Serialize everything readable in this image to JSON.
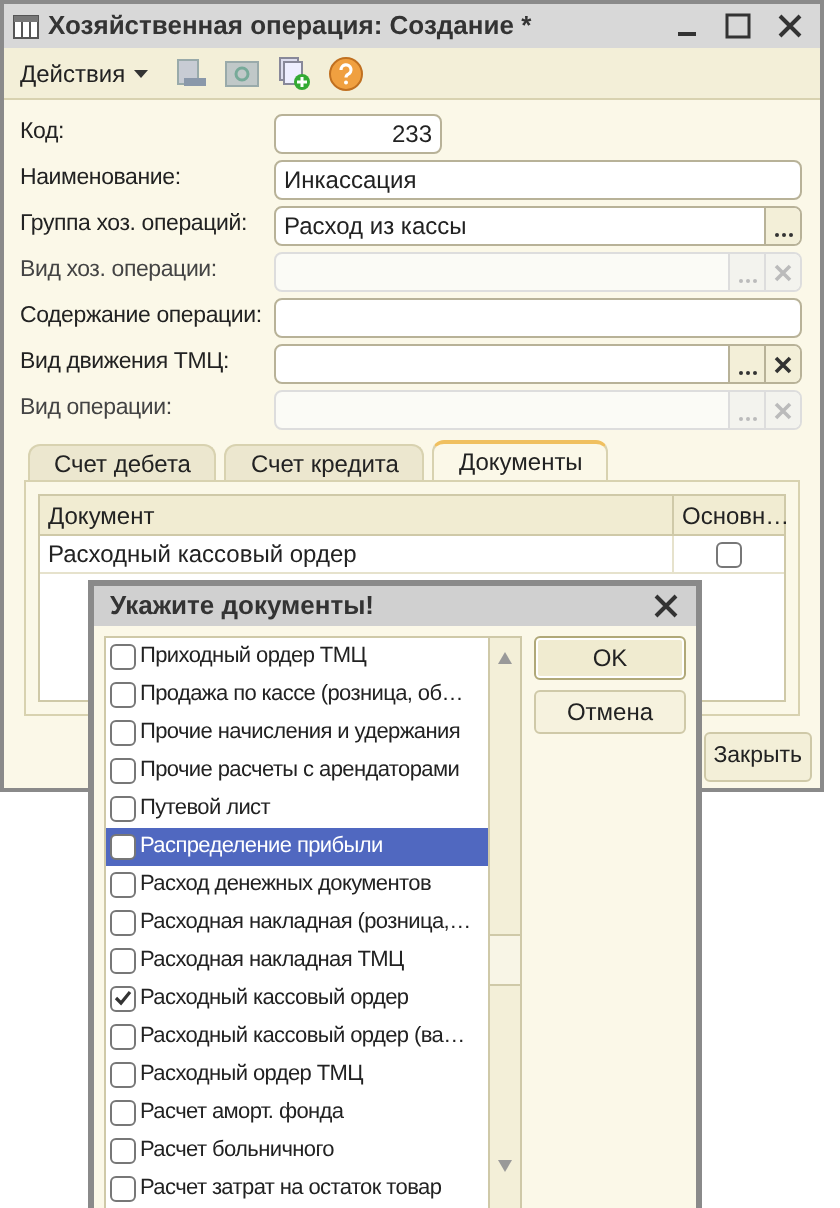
{
  "window": {
    "title": "Хозяйственная операция: Создание *"
  },
  "toolbar": {
    "actions_label": "Действия"
  },
  "fields": [
    {
      "label": "Код:",
      "value": "233",
      "kind": "number",
      "disabled": false
    },
    {
      "label": "Наименование:",
      "value": "Инкассация",
      "kind": "text",
      "disabled": false
    },
    {
      "label": "Группа хоз. операций:",
      "value": "Расход  из кассы",
      "kind": "select",
      "disabled": false
    },
    {
      "label": "Вид хоз. операции:",
      "kind": "select_clear",
      "disabled": true
    },
    {
      "label": "Содержание операции:",
      "kind": "text",
      "disabled": false
    },
    {
      "label": "Вид движения ТМЦ:",
      "kind": "select_clear",
      "disabled": false
    },
    {
      "label": "Вид операции:",
      "kind": "select_clear",
      "disabled": true
    }
  ],
  "tabs": [
    {
      "label": "Счет дебета",
      "selected": false
    },
    {
      "label": "Счет кредита",
      "selected": false
    },
    {
      "label": "Документы",
      "selected": true
    }
  ],
  "table": {
    "columns": [
      "Документ",
      "Основн…"
    ],
    "rows": [
      {
        "document": "Расходный кассовый ордер",
        "main": false
      }
    ]
  },
  "close_button": "Закрыть",
  "dialog": {
    "title": "Укажите документы!",
    "buttons": [
      "OK",
      "Отмена"
    ],
    "items": [
      {
        "label": "Приходный ордер ТМЦ",
        "checked": false,
        "selected": false
      },
      {
        "label": "Продажа по кассе (розница, об…",
        "checked": false,
        "selected": false
      },
      {
        "label": "Прочие начисления и удержания",
        "checked": false,
        "selected": false
      },
      {
        "label": "Прочие расчеты с арендаторами",
        "checked": false,
        "selected": false
      },
      {
        "label": "Путевой лист",
        "checked": false,
        "selected": false
      },
      {
        "label": "Распределение прибыли",
        "checked": false,
        "selected": true
      },
      {
        "label": "Расход денежных документов",
        "checked": false,
        "selected": false
      },
      {
        "label": "Расходная накладная (розница,…",
        "checked": false,
        "selected": false
      },
      {
        "label": "Расходная накладная ТМЦ",
        "checked": false,
        "selected": false
      },
      {
        "label": "Расходный кассовый ордер",
        "checked": true,
        "selected": false
      },
      {
        "label": "Расходный кассовый ордер (ва…",
        "checked": false,
        "selected": false
      },
      {
        "label": "Расходный ордер ТМЦ",
        "checked": false,
        "selected": false
      },
      {
        "label": "Расчет аморт. фонда",
        "checked": false,
        "selected": false
      },
      {
        "label": "Расчет больничного",
        "checked": false,
        "selected": false
      },
      {
        "label": "Расчет затрат на остаток товар",
        "checked": false,
        "selected": false
      }
    ]
  }
}
